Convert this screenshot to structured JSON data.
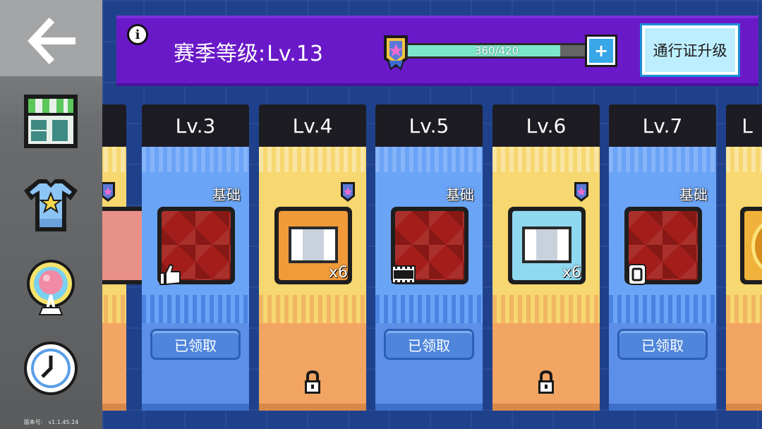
{
  "version": {
    "label": "版本号:",
    "value": "v1.1.45.24"
  },
  "sidebar": {
    "items": [
      {
        "icon": "back-arrow-icon"
      },
      {
        "icon": "shop-icon"
      },
      {
        "icon": "tshirt-icon"
      },
      {
        "icon": "balloon-icon"
      },
      {
        "icon": "clock-icon"
      }
    ]
  },
  "header": {
    "info_icon": "info-icon",
    "info_glyph": "i",
    "season_label": "赛季等级:",
    "season_level": "Lv.13",
    "xp_current": 360,
    "xp_max": 420,
    "xp_text": "360/420",
    "plus_label": "+",
    "upgrade_label": "通行证升级"
  },
  "cards": [
    {
      "level": "",
      "theme": "orange",
      "tier": "",
      "premium": true,
      "reward": "partial",
      "quantity": "",
      "status": "partial"
    },
    {
      "level": "Lv.3",
      "theme": "blue",
      "tier": "基础",
      "premium": false,
      "reward": "red-item",
      "type_icon": "thumbs-up-icon",
      "quantity": "",
      "status": "claimed",
      "claimed_label": "已领取"
    },
    {
      "level": "Lv.4",
      "theme": "orange",
      "tier": "",
      "premium": true,
      "reward": "ticket-orange",
      "quantity": "x6",
      "status": "locked"
    },
    {
      "level": "Lv.5",
      "theme": "blue",
      "tier": "基础",
      "premium": false,
      "reward": "red-item",
      "type_icon": "film-icon",
      "quantity": "",
      "status": "claimed",
      "claimed_label": "已领取"
    },
    {
      "level": "Lv.6",
      "theme": "orange",
      "tier": "",
      "premium": true,
      "reward": "ticket-blue",
      "quantity": "x6",
      "status": "locked"
    },
    {
      "level": "Lv.7",
      "theme": "blue",
      "tier": "基础",
      "premium": false,
      "reward": "red-item",
      "type_icon": "frame-icon",
      "quantity": "",
      "status": "claimed",
      "claimed_label": "已领取"
    },
    {
      "level": "L",
      "theme": "orange",
      "tier": "",
      "premium": false,
      "reward": "coin",
      "quantity": "",
      "status": "partial"
    }
  ],
  "colors": {
    "header": "#6a19c8",
    "xp_fill": "#7ee6c9",
    "claimed_button": "#4f86dc",
    "blue_card": "#5d8fe9",
    "orange_card": "#f2a562"
  }
}
